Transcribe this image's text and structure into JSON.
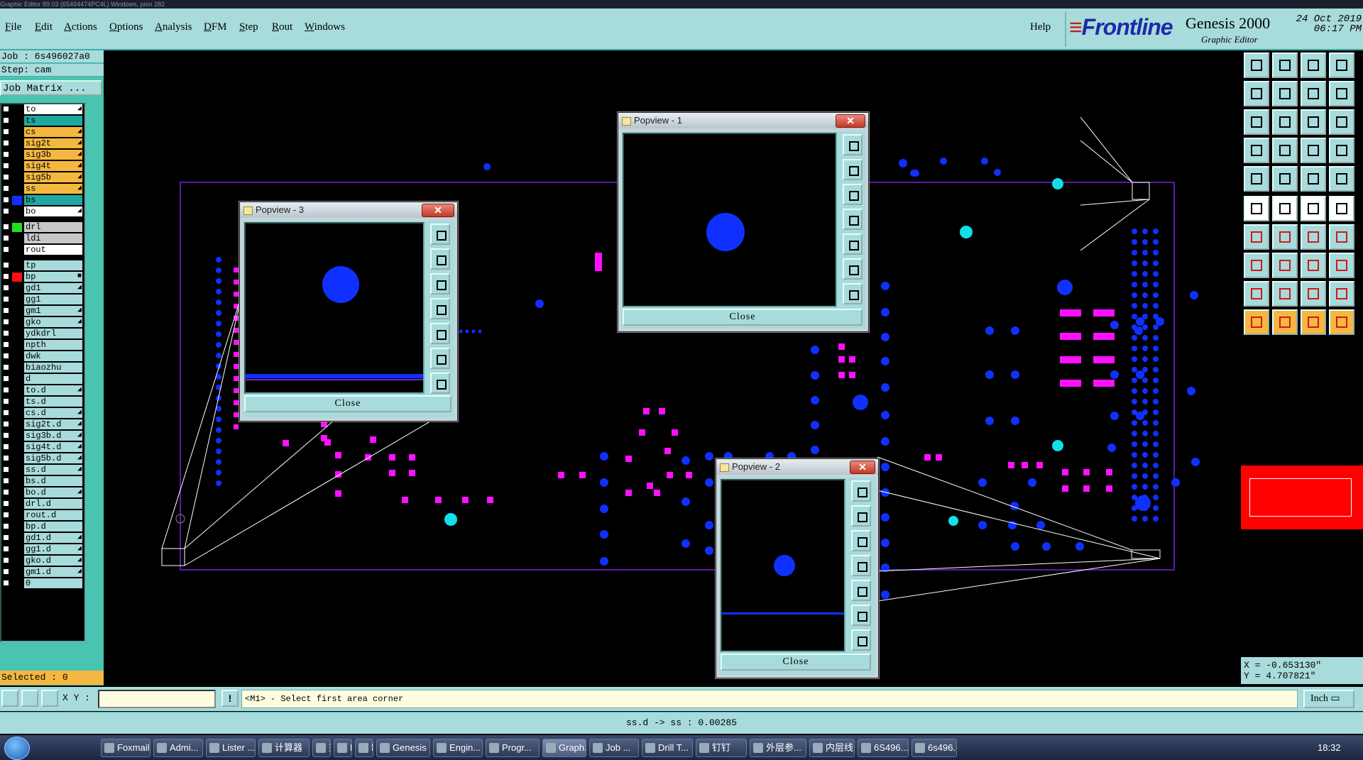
{
  "window_title": "Graphic Editor 89.03 (65494474PC4L) Windows, pion 282",
  "menu": [
    "File",
    "Edit",
    "Actions",
    "Options",
    "Analysis",
    "DFM",
    "Step",
    "Rout",
    "Windows"
  ],
  "help": "Help",
  "brand": {
    "logo": "Frontline",
    "product": "Genesis 2000",
    "subtitle": "Graphic Editor",
    "date": "24 Oct 2019",
    "time": "06:17 PM"
  },
  "job": {
    "job_line": "Job : 6s496027a0",
    "step_line": "Step: cam",
    "matrix_button": "Job Matrix ..."
  },
  "layers": [
    {
      "name": "to",
      "style": "w",
      "swatch": "",
      "tick": "◢"
    },
    {
      "name": "ts",
      "style": "t",
      "swatch": "",
      "tick": ""
    },
    {
      "name": "cs",
      "style": "o",
      "swatch": "",
      "tick": "◢"
    },
    {
      "name": "sig2t",
      "style": "o",
      "swatch": "",
      "tick": "◢"
    },
    {
      "name": "sig3b",
      "style": "o",
      "swatch": "",
      "tick": "◢"
    },
    {
      "name": "sig4t",
      "style": "o",
      "swatch": "",
      "tick": "◢"
    },
    {
      "name": "sig5b",
      "style": "o",
      "swatch": "",
      "tick": "◢"
    },
    {
      "name": "ss",
      "style": "o",
      "swatch": "",
      "tick": "◢"
    },
    {
      "name": "bs",
      "style": "t",
      "swatch": "#1030ff",
      "tick": ""
    },
    {
      "name": "bo",
      "style": "w",
      "swatch": "",
      "tick": "◢"
    },
    {
      "name": "drl",
      "style": "g",
      "swatch": "#20e020",
      "tick": ""
    },
    {
      "name": "ldi",
      "style": "g",
      "swatch": "",
      "tick": ""
    },
    {
      "name": "rout",
      "style": "w",
      "swatch": "",
      "tick": ""
    },
    {
      "name": "tp",
      "style": "",
      "swatch": "",
      "tick": ""
    },
    {
      "name": "bp",
      "style": "",
      "swatch": "#ff1010",
      "tick": "■"
    },
    {
      "name": "gd1",
      "style": "",
      "swatch": "",
      "tick": "◢"
    },
    {
      "name": "gg1",
      "style": "",
      "swatch": "",
      "tick": ""
    },
    {
      "name": "gm1",
      "style": "",
      "swatch": "",
      "tick": "◢"
    },
    {
      "name": "gko",
      "style": "",
      "swatch": "",
      "tick": "◢"
    },
    {
      "name": "ydkdrl",
      "style": "",
      "swatch": "",
      "tick": ""
    },
    {
      "name": "npth",
      "style": "",
      "swatch": "",
      "tick": ""
    },
    {
      "name": "dwk",
      "style": "",
      "swatch": "",
      "tick": ""
    },
    {
      "name": "biaozhu",
      "style": "",
      "swatch": "",
      "tick": ""
    },
    {
      "name": "d",
      "style": "",
      "swatch": "",
      "tick": ""
    },
    {
      "name": "to.d",
      "style": "",
      "swatch": "",
      "tick": "◢"
    },
    {
      "name": "ts.d",
      "style": "",
      "swatch": "",
      "tick": ""
    },
    {
      "name": "cs.d",
      "style": "",
      "swatch": "",
      "tick": "◢"
    },
    {
      "name": "sig2t.d",
      "style": "",
      "swatch": "",
      "tick": "◢"
    },
    {
      "name": "sig3b.d",
      "style": "",
      "swatch": "",
      "tick": "◢"
    },
    {
      "name": "sig4t.d",
      "style": "",
      "swatch": "",
      "tick": "◢"
    },
    {
      "name": "sig5b.d",
      "style": "",
      "swatch": "",
      "tick": "◢"
    },
    {
      "name": "ss.d",
      "style": "",
      "swatch": "",
      "tick": "◢"
    },
    {
      "name": "bs.d",
      "style": "",
      "swatch": "",
      "tick": ""
    },
    {
      "name": "bo.d",
      "style": "",
      "swatch": "",
      "tick": "◢"
    },
    {
      "name": "drl.d",
      "style": "",
      "swatch": "",
      "tick": ""
    },
    {
      "name": "rout.d",
      "style": "",
      "swatch": "",
      "tick": ""
    },
    {
      "name": "bp.d",
      "style": "",
      "swatch": "",
      "tick": ""
    },
    {
      "name": "gd1.d",
      "style": "",
      "swatch": "",
      "tick": "◢"
    },
    {
      "name": "gg1.d",
      "style": "",
      "swatch": "",
      "tick": "◢"
    },
    {
      "name": "gko.d",
      "style": "",
      "swatch": "",
      "tick": "◢"
    },
    {
      "name": "gm1.d",
      "style": "",
      "swatch": "",
      "tick": "◢"
    },
    {
      "name": "0",
      "style": "",
      "swatch": "",
      "tick": ""
    }
  ],
  "selected": "Selected : 0",
  "popviews": [
    {
      "title": "Popview - 1",
      "close": "Close"
    },
    {
      "title": "Popview - 2",
      "close": "Close"
    },
    {
      "title": "Popview - 3",
      "close": "Close"
    }
  ],
  "coords": {
    "x": "X = -0.653130\"",
    "y": "Y = 4.707821\""
  },
  "command": {
    "xy_label": "X Y :",
    "xy_value": "",
    "prompt": "<M1> - Select first area corner",
    "unit": "Inch"
  },
  "status": "ss.d -> ss : 0.00285",
  "taskbar": {
    "items": [
      "Foxmail",
      "Admi...",
      "Lister ...",
      "计算器",
      "兴森快...",
      "EDS工...",
      "制作规...",
      "Genesis",
      "Engin...",
      "Progr...",
      "Graph...",
      "Job ...",
      "Drill T...",
      "钉钉",
      "外层参...",
      "内层线...",
      "6S496...",
      "6s496..."
    ],
    "clock": "18:32"
  },
  "colors": {
    "panel": "#a8dbdb",
    "pad_blue": "#1030ff",
    "pad_magenta": "#ff10ff",
    "pad_cyan": "#10e0e8",
    "outline": "#8020e0"
  },
  "icons": {
    "pop_tool": [
      "zoom-fit-icon",
      "zoom-in-icon",
      "zoom-out-icon",
      "pan-icon",
      "pan-right-icon",
      "fit-all-icon",
      "home-icon"
    ]
  }
}
